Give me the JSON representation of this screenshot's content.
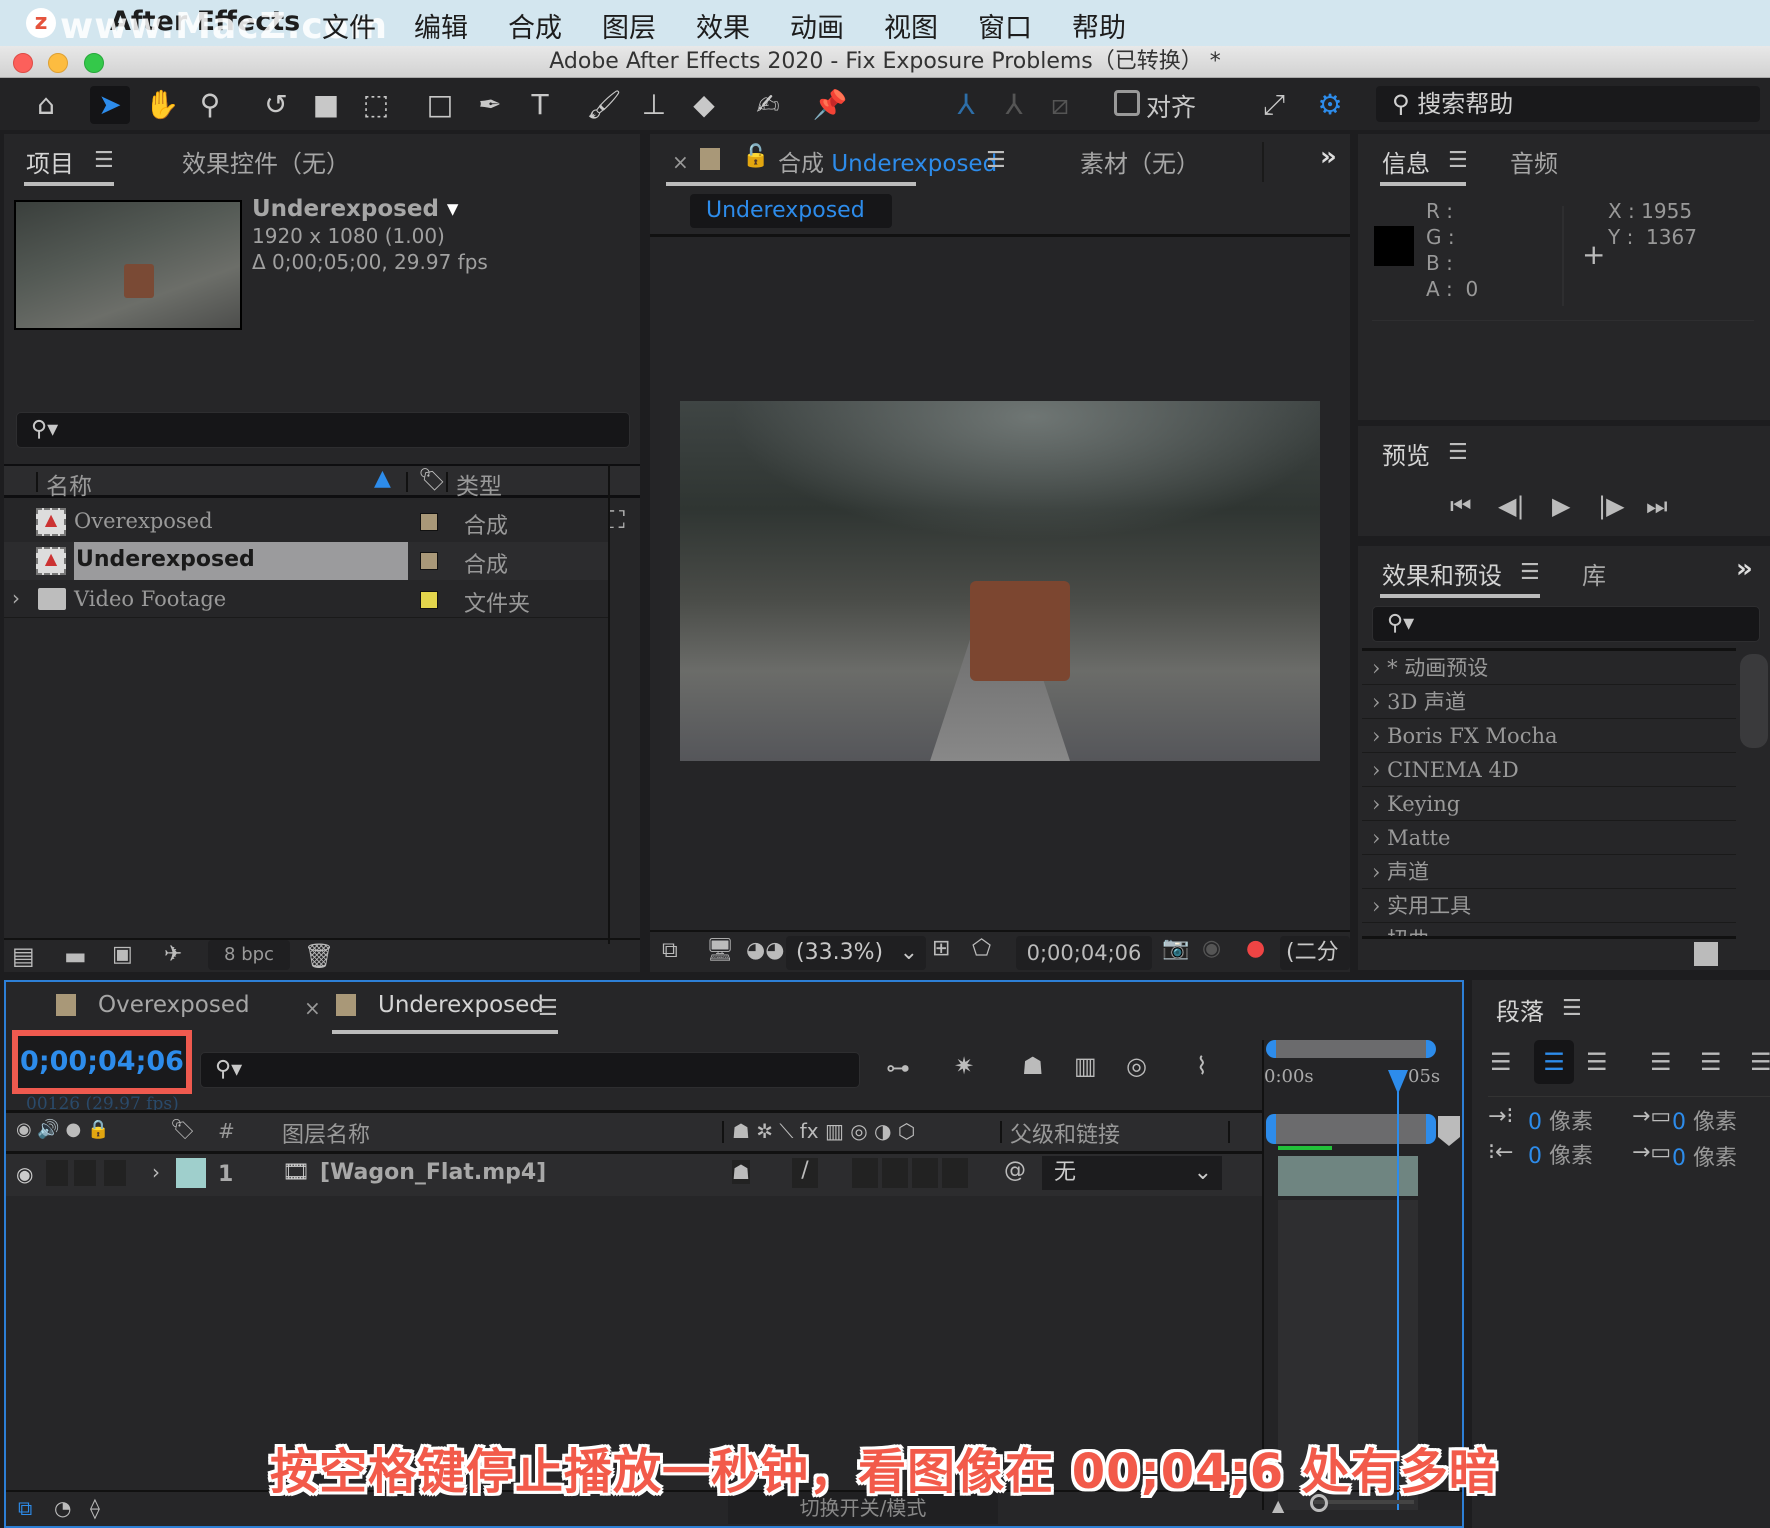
{
  "menubar": {
    "watermark": "www.MacZ.com",
    "app_name": "After Effects",
    "items": [
      "文件",
      "编辑",
      "合成",
      "图层",
      "效果",
      "动画",
      "视图",
      "窗口",
      "帮助"
    ]
  },
  "window": {
    "title": "Adobe After Effects 2020 - Fix Exposure Problems（已转换） *"
  },
  "toolbar": {
    "tools": [
      "home-icon",
      "selection-arrow-icon",
      "hand-icon",
      "zoom-icon",
      "rotate-icon",
      "camera-icon",
      "pan-behind-icon",
      "rectangle-icon",
      "pen-icon",
      "text-icon",
      "brush-icon",
      "clone-stamp-icon",
      "eraser-icon",
      "roto-brush-icon",
      "puppet-pin-icon"
    ],
    "snap_label": "对齐",
    "help_search_placeholder": "搜索帮助"
  },
  "project_panel": {
    "tab_project": "项目",
    "tab_effect_controls": "效果控件（无）",
    "selected_name": "Underexposed",
    "selected_dims": "1920 x 1080 (1.00)",
    "selected_duration": "Δ 0;00;05;00, 29.97 fps",
    "col_name": "名称",
    "col_type": "类型",
    "items": [
      {
        "name": "Overexposed",
        "type": "合成",
        "label_color": "#a99878",
        "kind": "comp"
      },
      {
        "name": "Underexposed",
        "type": "合成",
        "label_color": "#a99878",
        "kind": "comp",
        "selected": true
      },
      {
        "name": "Video Footage",
        "type": "文件夹",
        "label_color": "#e2d54c",
        "kind": "folder"
      }
    ],
    "bpc": "8 bpc"
  },
  "comp_panel": {
    "tab_prefix": "合成",
    "tab_name": "Underexposed",
    "footage_tab": "素材（无）",
    "breadcrumb": "Underexposed",
    "zoom": "(33.3%)",
    "timecode": "0;00;04;06",
    "resolution": "(二分"
  },
  "info_panel": {
    "tab_info": "信息",
    "tab_audio": "音频",
    "r_label": "R :",
    "g_label": "G :",
    "b_label": "B :",
    "a_label": "A :",
    "a_value": "0",
    "x_label": "X :",
    "x_value": "1955",
    "y_label": "Y :",
    "y_value": "1367"
  },
  "preview_panel": {
    "title": "预览"
  },
  "effects_panel": {
    "tab_effects": "效果和预设",
    "tab_library": "库",
    "items": [
      "* 动画预设",
      "3D 声道",
      "Boris FX Mocha",
      "CINEMA 4D",
      "Keying",
      "Matte",
      "声道",
      "实用工具",
      "扭曲"
    ]
  },
  "timeline": {
    "tabs": [
      {
        "label": "Overexposed",
        "color": "#a99878"
      },
      {
        "label": "Underexposed",
        "color": "#a99878",
        "active": true
      }
    ],
    "timecode": "0;00;04;06",
    "frame_info": "00126 (29.97 fps)",
    "col_layer_name": "图层名称",
    "col_parent": "父级和链接",
    "col_num": "#",
    "ruler_start": "0:00s",
    "ruler_end": "05s",
    "layers": [
      {
        "num": "1",
        "name": "[Wagon_Flat.mp4]",
        "label_color": "#9fcfcc",
        "parent": "无"
      }
    ],
    "toggle_label": "切换开关/模式"
  },
  "paragraph_panel": {
    "title": "段落",
    "indents": [
      "0 像素",
      "0 像素",
      "0 像素",
      "0 像素"
    ]
  },
  "caption": "按空格键停止播放一秒钟，看图像在 00;04;6 处有多暗"
}
